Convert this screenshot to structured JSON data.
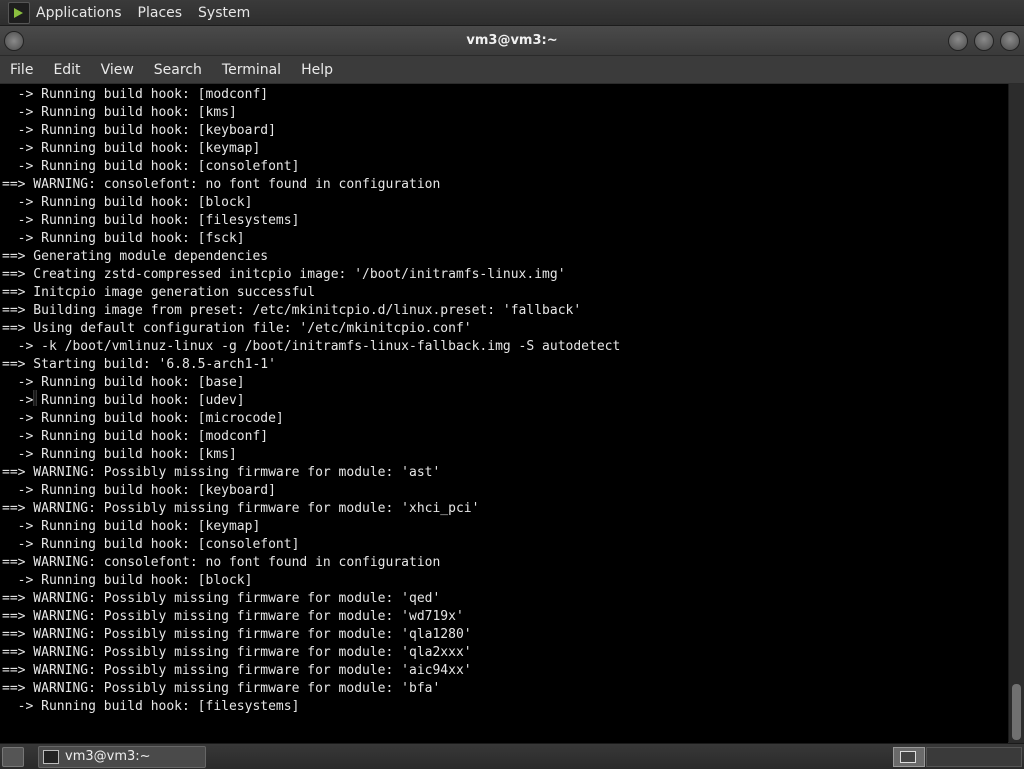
{
  "top_panel": {
    "items": [
      "Applications",
      "Places",
      "System"
    ]
  },
  "window": {
    "title": "vm3@vm3:~"
  },
  "terminal_menu": {
    "items": [
      "File",
      "Edit",
      "View",
      "Search",
      "Terminal",
      "Help"
    ]
  },
  "terminal": {
    "lines": [
      "  -> Running build hook: [modconf]",
      "  -> Running build hook: [kms]",
      "  -> Running build hook: [keyboard]",
      "  -> Running build hook: [keymap]",
      "  -> Running build hook: [consolefont]",
      "==> WARNING: consolefont: no font found in configuration",
      "  -> Running build hook: [block]",
      "  -> Running build hook: [filesystems]",
      "  -> Running build hook: [fsck]",
      "==> Generating module dependencies",
      "==> Creating zstd-compressed initcpio image: '/boot/initramfs-linux.img'",
      "==> Initcpio image generation successful",
      "==> Building image from preset: /etc/mkinitcpio.d/linux.preset: 'fallback'",
      "==> Using default configuration file: '/etc/mkinitcpio.conf'",
      "  -> -k /boot/vmlinuz-linux -g /boot/initramfs-linux-fallback.img -S autodetect",
      "==> Starting build: '6.8.5-arch1-1'",
      "  -> Running build hook: [base]",
      "  -> Running build hook: [udev]",
      "  -> Running build hook: [microcode]",
      "  -> Running build hook: [modconf]",
      "  -> Running build hook: [kms]",
      "==> WARNING: Possibly missing firmware for module: 'ast'",
      "  -> Running build hook: [keyboard]",
      "==> WARNING: Possibly missing firmware for module: 'xhci_pci'",
      "  -> Running build hook: [keymap]",
      "  -> Running build hook: [consolefont]",
      "==> WARNING: consolefont: no font found in configuration",
      "  -> Running build hook: [block]",
      "==> WARNING: Possibly missing firmware for module: 'qed'",
      "==> WARNING: Possibly missing firmware for module: 'wd719x'",
      "==> WARNING: Possibly missing firmware for module: 'qla1280'",
      "==> WARNING: Possibly missing firmware for module: 'qla2xxx'",
      "==> WARNING: Possibly missing firmware for module: 'aic94xx'",
      "==> WARNING: Possibly missing firmware for module: 'bfa'",
      "  -> Running build hook: [filesystems]"
    ]
  },
  "taskbar": {
    "window_button_label": "vm3@vm3:~"
  }
}
